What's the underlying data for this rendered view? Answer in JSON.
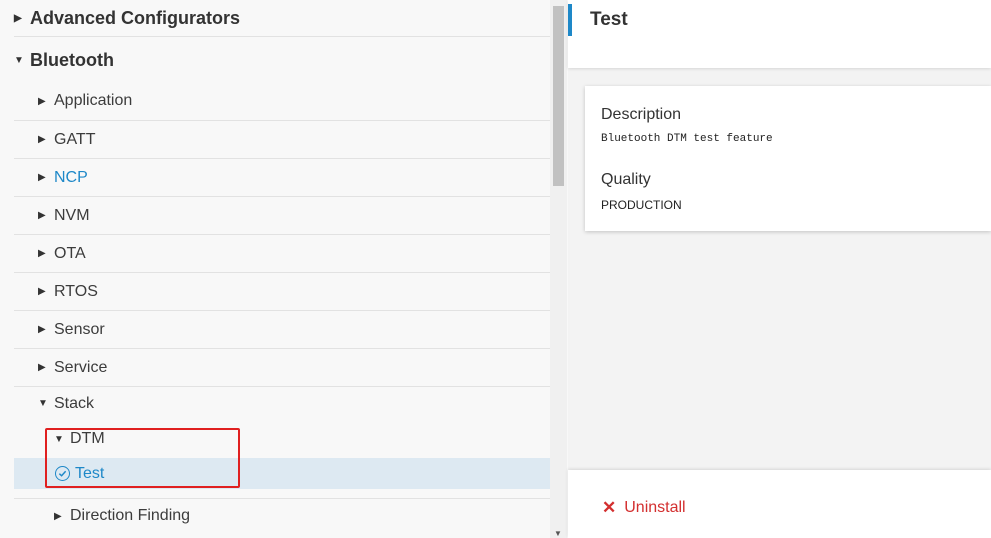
{
  "tree": {
    "items": [
      {
        "label": "Advanced Configurators",
        "expanded": false
      },
      {
        "label": "Bluetooth",
        "expanded": true
      },
      {
        "label": "Application"
      },
      {
        "label": "GATT"
      },
      {
        "label": "NCP"
      },
      {
        "label": "NVM"
      },
      {
        "label": "OTA"
      },
      {
        "label": "RTOS"
      },
      {
        "label": "Sensor"
      },
      {
        "label": "Service"
      },
      {
        "label": "Stack",
        "expanded": true
      },
      {
        "label": "DTM",
        "expanded": true
      },
      {
        "label": "Test",
        "selected": true
      },
      {
        "label": "Direction Finding"
      }
    ]
  },
  "detail": {
    "title": "Test",
    "description_label": "Description",
    "description_value": "Bluetooth DTM test feature",
    "quality_label": "Quality",
    "quality_value": "PRODUCTION",
    "uninstall_label": "Uninstall"
  },
  "colors": {
    "accent": "#1e88c8",
    "danger": "#d32f2f",
    "highlight": "#e02020"
  }
}
